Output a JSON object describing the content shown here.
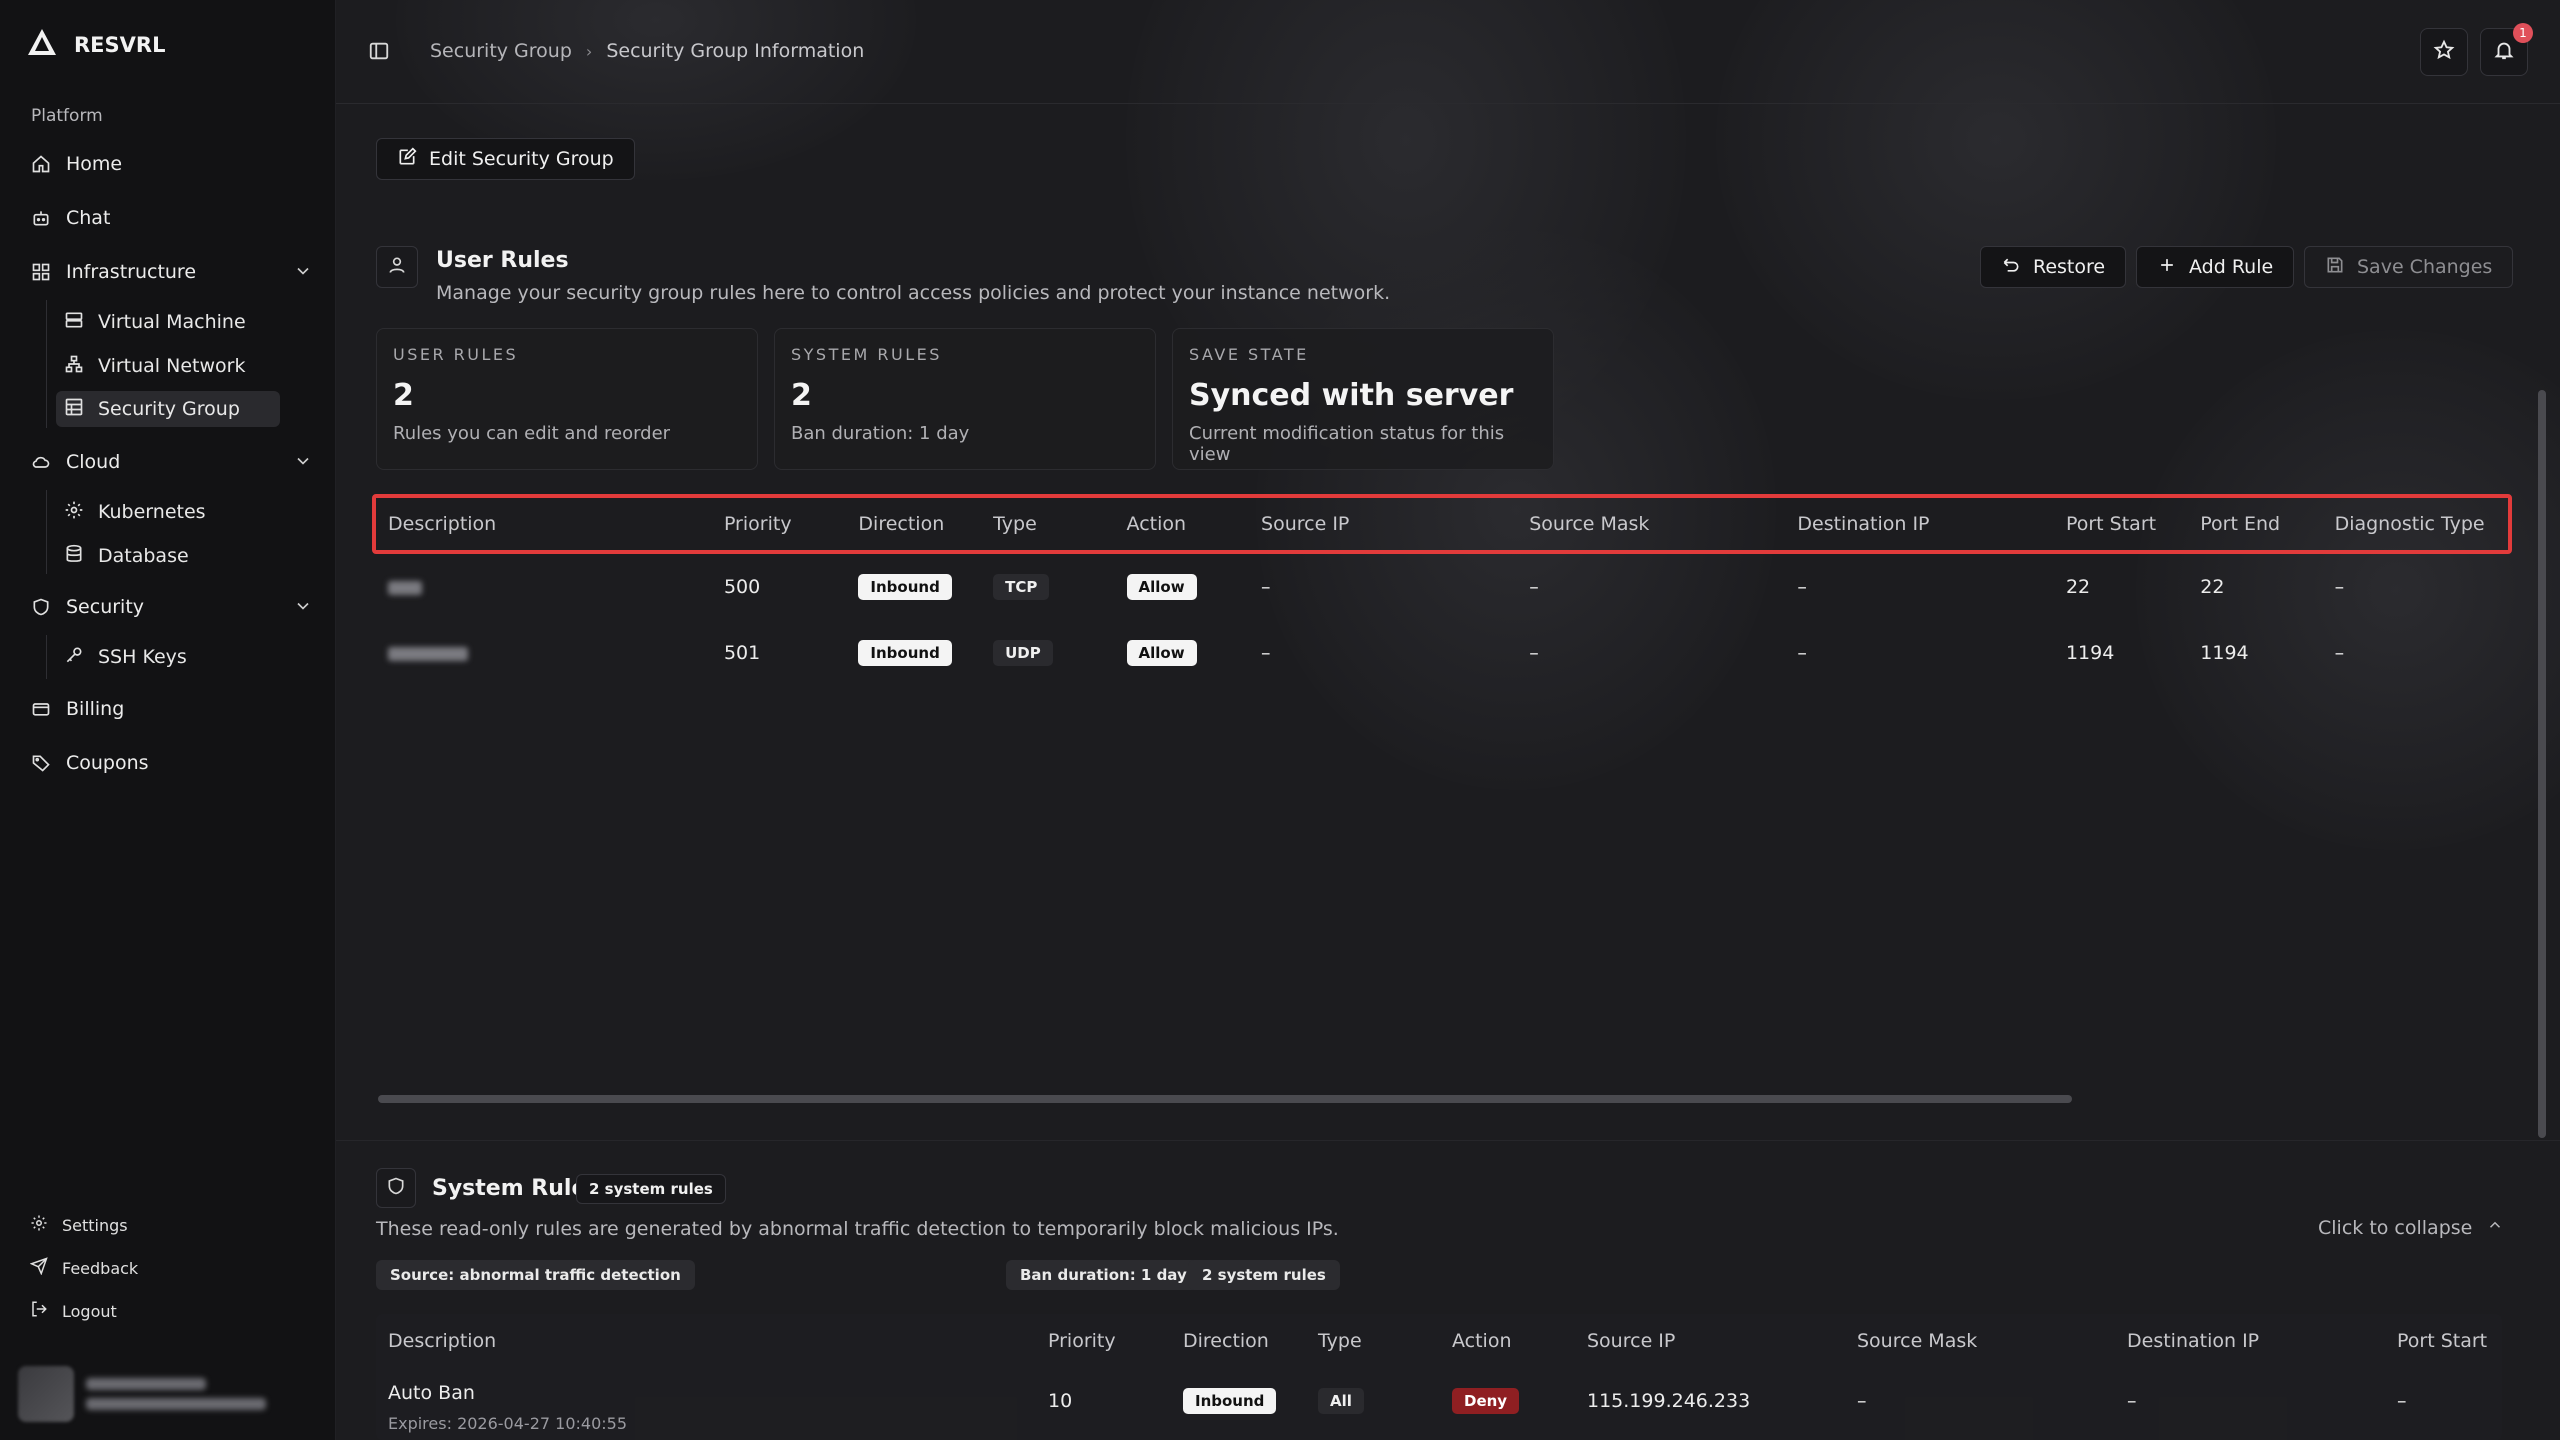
{
  "brand": {
    "name": "RESVRL"
  },
  "sidebar": {
    "section_label": "Platform",
    "items": [
      {
        "label": "Home"
      },
      {
        "label": "Chat"
      },
      {
        "label": "Infrastructure"
      },
      {
        "label": "Virtual Machine"
      },
      {
        "label": "Virtual Network"
      },
      {
        "label": "Security Group"
      },
      {
        "label": "Cloud"
      },
      {
        "label": "Kubernetes"
      },
      {
        "label": "Database"
      },
      {
        "label": "Security"
      },
      {
        "label": "SSH Keys"
      },
      {
        "label": "Billing"
      },
      {
        "label": "Coupons"
      }
    ],
    "bottom": {
      "settings": "Settings",
      "feedback": "Feedback",
      "logout": "Logout"
    }
  },
  "breadcrumb": {
    "parent": "Security Group",
    "current": "Security Group Information"
  },
  "header": {
    "notification_count": "1"
  },
  "actions": {
    "edit_security_group": "Edit Security Group",
    "restore": "Restore",
    "add_rule": "Add Rule",
    "save_changes": "Save Changes"
  },
  "user_rules": {
    "title": "User Rules",
    "description": "Manage your security group rules here to control access policies and protect your instance network."
  },
  "stats": [
    {
      "label": "USER RULES",
      "value": "2",
      "sub": "Rules you can edit and reorder"
    },
    {
      "label": "SYSTEM RULES",
      "value": "2",
      "sub": "Ban duration: 1 day"
    },
    {
      "label": "SAVE STATE",
      "value": "Synced with server",
      "sub": "Current modification status for this view"
    }
  ],
  "rules_table": {
    "columns": [
      "Description",
      "Priority",
      "Direction",
      "Type",
      "Action",
      "Source IP",
      "Source Mask",
      "Destination IP",
      "Port Start",
      "Port End",
      "Diagnostic Type"
    ],
    "rows": [
      {
        "priority": "500",
        "direction": "Inbound",
        "type": "TCP",
        "action": "Allow",
        "source_ip": "–",
        "source_mask": "–",
        "destination_ip": "–",
        "port_start": "22",
        "port_end": "22",
        "diagnostic_type": "–"
      },
      {
        "priority": "501",
        "direction": "Inbound",
        "type": "UDP",
        "action": "Allow",
        "source_ip": "–",
        "source_mask": "–",
        "destination_ip": "–",
        "port_start": "1194",
        "port_end": "1194",
        "diagnostic_type": "–"
      }
    ]
  },
  "system_rules": {
    "title": "System Rules",
    "count_badge": "2 system rules",
    "description": "These read-only rules are generated by abnormal traffic detection to temporarily block malicious IPs.",
    "collapse_label": "Click to collapse",
    "chips": [
      "Source: abnormal traffic detection",
      "Ban duration: 1 day",
      "2 system rules"
    ],
    "columns": [
      "Description",
      "Priority",
      "Direction",
      "Type",
      "Action",
      "Source IP",
      "Source Mask",
      "Destination IP",
      "Port Start"
    ],
    "rows": [
      {
        "description": "Auto Ban",
        "expires": "Expires: 2026-04-27 10:40:55",
        "priority": "10",
        "direction": "Inbound",
        "type": "All",
        "action": "Deny",
        "source_ip": "115.199.246.233",
        "source_mask": "–",
        "destination_ip": "–",
        "port_start": "–"
      }
    ]
  }
}
